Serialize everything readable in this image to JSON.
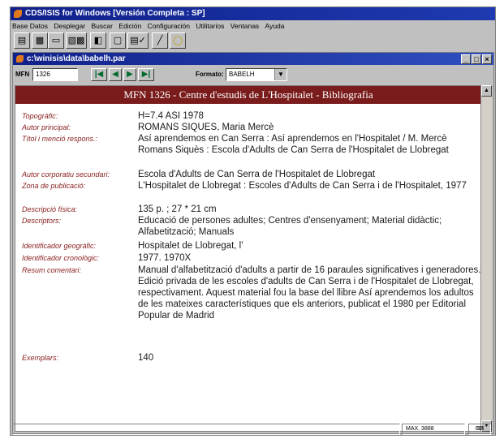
{
  "window": {
    "title": "CDS/ISIS for Windows [Versión Completa : SP]"
  },
  "menu": [
    "Base Datos",
    "Desplegar",
    "Buscar",
    "Edición",
    "Configuración",
    "Utilitarios",
    "Ventanas",
    "Ayuda"
  ],
  "toolbar": [
    {
      "icon": "open-database-icon"
    },
    {
      "icon": "browse-icon"
    },
    {
      "icon": "search-icon"
    },
    {
      "icon": "print-preview-icon"
    },
    {
      "icon": "print-icon"
    },
    {
      "icon": "edit-icon"
    },
    {
      "icon": "pen-icon"
    },
    {
      "icon": "help-icon"
    }
  ],
  "child_window": {
    "title": "c:\\winisis\\data\\babelh.par",
    "buttons": [
      "_",
      "□",
      "×"
    ]
  },
  "nav": {
    "mfn_label": "MFN",
    "mfn_value": "1326",
    "format_label": "Formato:",
    "format_value": "BABELH"
  },
  "record": {
    "header": "MFN 1326 - Centre d'estudis de L'Hospitalet - Bibliografia",
    "fields": [
      {
        "label": "Topogràfic:",
        "value": "H=7.4 ASI 1978"
      },
      {
        "label": "Autor principal:",
        "value": "ROMANS SIQUES, Maria Mercè"
      },
      {
        "label": "Títol i menció respons.:",
        "value": "Así aprendemos en Can Serra : Así aprendemos en l'Hospitalet / M. Mercè Romans Siquès : Escola d'Adults de Can Serra de l'Hospitalet de Llobregat"
      },
      {
        "label": "Autor corporatiu secundari:",
        "value": "Escola d'Adults de Can Serra de l'Hospitalet de Llobregat"
      },
      {
        "label": "Zona de publicació:",
        "value": "L'Hospitalet de Llobregat : Escoles d'Adults de Can Serra i de l'Hospitalet, 1977"
      },
      {
        "label": "Descripció física:",
        "value": "135 p. ; 27 * 21 cm"
      },
      {
        "label": "Descriptors:",
        "value": "Educació de persones adultes; Centres d'ensenyament; Material didàctic; Alfabetització; Manuals"
      },
      {
        "label": "Identificador geogràfic:",
        "value": "Hospitalet de Llobregat, l'"
      },
      {
        "label": "Identificador cronològic:",
        "value": "1977. 1970X"
      },
      {
        "label": "Resum comentari:",
        "value": "Manual d'alfabetització d'adults a partir de 16 paraules significatives i generadores. Edició privada de les escoles d'adults de Can Serra i de l'Hospitalet de Llobregat, respectivament. Aquest material fou la base del llibre Así aprendemos los adultos de les mateixes característiques que els anteriors, publicat el 1980 per Editorial Popular de Madrid"
      },
      {
        "label": "Exemplars:",
        "value": "140"
      }
    ]
  },
  "status": {
    "mode": "MAX. 3888",
    "icon": "keyboard-icon"
  }
}
